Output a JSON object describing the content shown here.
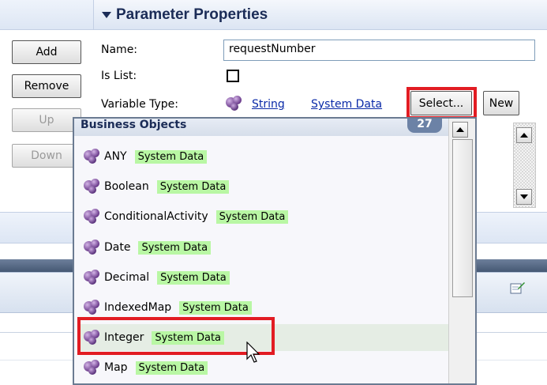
{
  "properties_panel": {
    "title": "Parameter Properties",
    "name_label": "Name:",
    "name_value": "requestNumber",
    "is_list_label": "Is List:",
    "variable_type_label": "Variable Type:",
    "variable_type_value": "String",
    "variable_type_source": "System Data",
    "select_button": "Select...",
    "new_button": "New"
  },
  "side_buttons": {
    "add": "Add",
    "remove": "Remove",
    "up": "Up",
    "down": "Down"
  },
  "popup": {
    "title": "Business Objects",
    "count": "27",
    "items": [
      {
        "name": "ANY",
        "tag": "System Data"
      },
      {
        "name": "Boolean",
        "tag": "System Data"
      },
      {
        "name": "ConditionalActivity",
        "tag": "System Data"
      },
      {
        "name": "Date",
        "tag": "System Data"
      },
      {
        "name": "Decimal",
        "tag": "System Data"
      },
      {
        "name": "IndexedMap",
        "tag": "System Data"
      },
      {
        "name": "Integer",
        "tag": "System Data"
      },
      {
        "name": "Map",
        "tag": "System Data"
      }
    ]
  },
  "colors": {
    "highlight": "#e21c23",
    "tag_bg": "#b9f7a4",
    "link": "#0a2aa8"
  },
  "icons": {
    "business_object": "business-object-icon",
    "cursor": "mouse-cursor-icon",
    "edit": "edit-icon"
  }
}
